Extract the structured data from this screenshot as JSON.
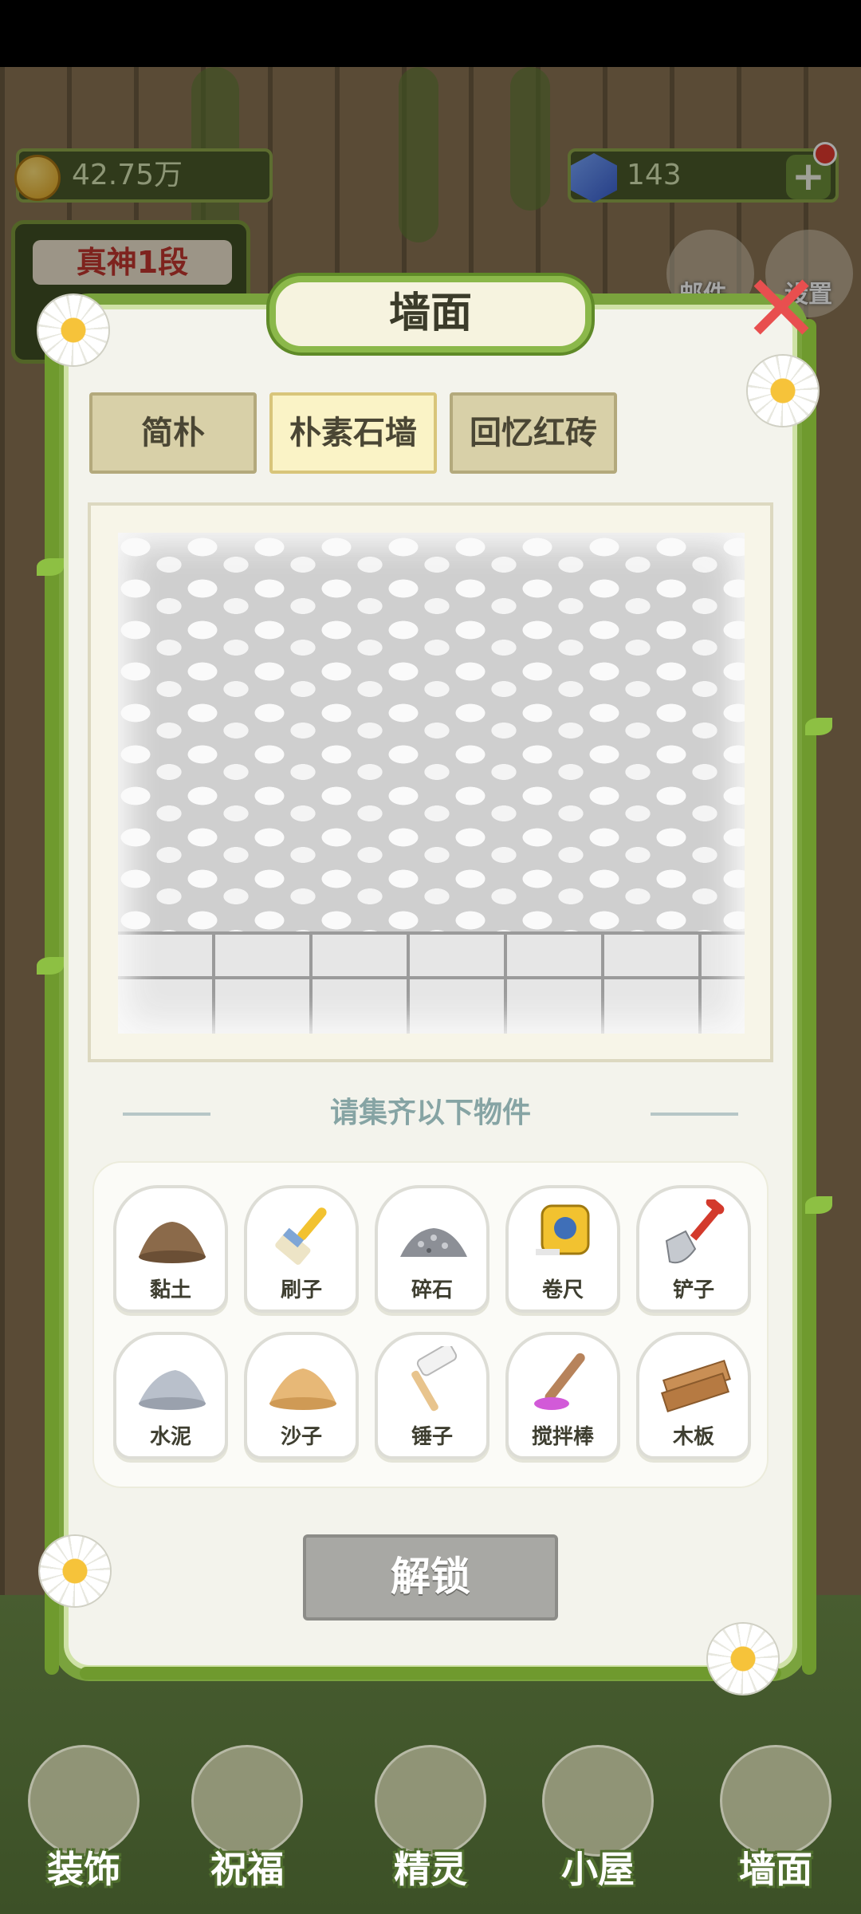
{
  "hud": {
    "coins": "42.75万",
    "gems": "143",
    "rank": "真神1段"
  },
  "dialog": {
    "title": "墙面",
    "tabs": [
      {
        "label": "简朴",
        "active": false
      },
      {
        "label": "朴素石墙",
        "active": true
      },
      {
        "label": "回忆红砖",
        "active": false
      }
    ],
    "collect_title": "请集齐以下物件",
    "items": [
      {
        "label": "黏土",
        "icon": "clay-pile-icon"
      },
      {
        "label": "刷子",
        "icon": "brush-icon"
      },
      {
        "label": "碎石",
        "icon": "gravel-icon"
      },
      {
        "label": "卷尺",
        "icon": "tape-measure-icon"
      },
      {
        "label": "铲子",
        "icon": "shovel-icon"
      },
      {
        "label": "水泥",
        "icon": "cement-pile-icon"
      },
      {
        "label": "沙子",
        "icon": "sand-pile-icon"
      },
      {
        "label": "锤子",
        "icon": "hammer-icon"
      },
      {
        "label": "搅拌棒",
        "icon": "stir-stick-icon"
      },
      {
        "label": "木板",
        "icon": "wood-plank-icon"
      }
    ],
    "unlock_label": "解锁"
  },
  "side": {
    "mail_label": "邮件",
    "settings_label": "设置"
  },
  "bottom_nav": [
    {
      "label": "装饰"
    },
    {
      "label": "祝福"
    },
    {
      "label": "精灵"
    },
    {
      "label": "小屋"
    },
    {
      "label": "墙面"
    }
  ],
  "colors": {
    "vine_green": "#7aa33d",
    "dialog_bg": "#f3f3ec",
    "unlock_disabled": "#a8a8a4",
    "close_red": "#e84f4f"
  }
}
